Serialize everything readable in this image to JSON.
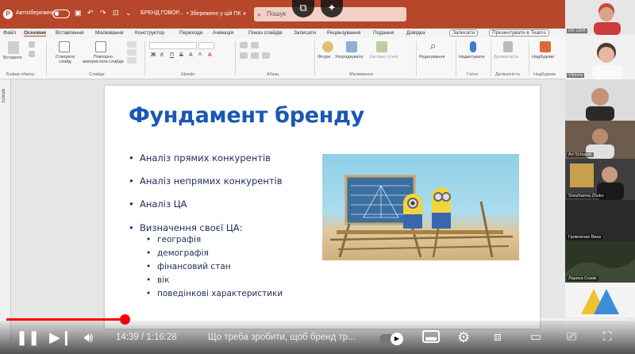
{
  "powerpoint": {
    "autosave_label": "Автозбереження",
    "doc_name": "БРЕНД ГОВОР...",
    "saved_status": "• Збережено у цій ПК ∨",
    "search_placeholder": "Пошук",
    "tabs": [
      "Файл",
      "Основне",
      "Вставлення",
      "Малювання",
      "Конструктор",
      "Переходи",
      "Анімація",
      "Показ слайдів",
      "Записати",
      "Рецензування",
      "Подання",
      "Довідка"
    ],
    "record_button": "Записати",
    "teams_button": "Презентувати в Teams",
    "ribbon": {
      "paste": "Вставити",
      "new_slide": "Створити слайд",
      "reuse": "Повторно використати слайди",
      "shapes": "Фігури",
      "arrange": "Упорядкувати",
      "quick_styles": "Експрес-стилі",
      "editing": "Редагування",
      "dictate": "Надиктувати",
      "sensitivity": "Делікатність",
      "designer": "Надбудови",
      "groups": [
        "Буфер обміну",
        "Слайди",
        "Шрифт",
        "Абзац",
        "Малювання",
        "Голос",
        "Делікатність",
        "Надбудови"
      ]
    },
    "side_label": "Ескізи"
  },
  "slide": {
    "title": "Фундамент бренду",
    "bullets": [
      "Аналіз прямих конкурентів",
      "Аналіз непрямих конкурентів",
      "Аналіз ЦА",
      "Визначення своєї ЦА:"
    ],
    "sub_bullets": [
      "географія",
      "демографія",
      "фінансовий стан",
      "вік",
      "поведінкові характеристики"
    ]
  },
  "participants": [
    {
      "name": "DR ЦІКА",
      "skin": "#d9a48a",
      "bg": "#e6e6e6"
    },
    {
      "name": "Viktoria",
      "skin": "#e5b8a2",
      "bg": "#f1f1f1"
    },
    {
      "name": "",
      "skin": "#c49479",
      "bg": "#dcdcdc"
    },
    {
      "name": "Ari Schupak",
      "skin": "#b88c70",
      "bg": "#6d5b4d"
    },
    {
      "name": "Snezhanna Zhuko",
      "skin": "#c79a80",
      "bg": "#3e3e3e"
    },
    {
      "name": "Громченко Вика",
      "skin": "",
      "bg": "#2a2a2a"
    },
    {
      "name": "Лариса Сєміж",
      "skin": "",
      "bg": "#1a1a1a"
    }
  ],
  "player": {
    "current_time": "14:39",
    "duration": "1:16:28",
    "time_display": "14:39 / 1:16:28",
    "title": "Що треба зробити, щоб бренд тр...",
    "progress_fraction": 0.19,
    "icons": [
      "pause-icon",
      "next-icon",
      "volume-icon",
      "autoplay-toggle",
      "subtitles-icon",
      "settings-icon",
      "miniplayer-icon",
      "theater-icon",
      "cast-icon",
      "fullscreen-icon"
    ]
  }
}
